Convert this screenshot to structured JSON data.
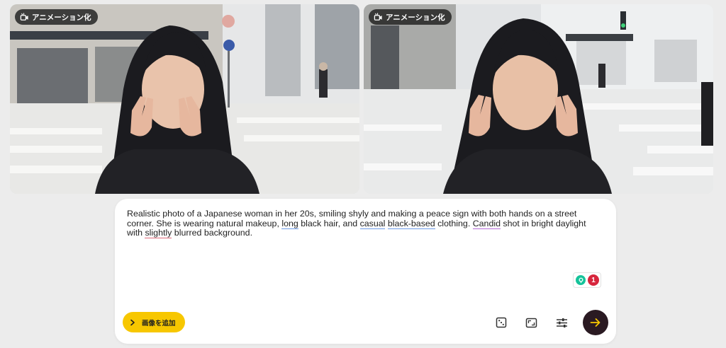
{
  "images": [
    {
      "badge_label": "アニメーション化",
      "badge_icon": "animate-icon"
    },
    {
      "badge_label": "アニメーション化",
      "badge_icon": "animate-icon"
    }
  ],
  "composer": {
    "prompt_parts": {
      "p1": "Realistic photo of a Japanese woman in her 20s, smiling shyly and making a peace sign with both hands on a street corner. She is wearing natural makeup, ",
      "w_long": "long",
      "p2": " black hair, and ",
      "w_casual": "casual",
      "p3": " ",
      "w_black": "black-based",
      "p4": " clothing. ",
      "w_candid": "Candid",
      "p5": " shot in bright daylight with ",
      "w_slightly": "slightly",
      "p6": " blurred background."
    },
    "grammar_count": "1",
    "add_image_label": "画像を追加",
    "tools": [
      "dice-icon",
      "aspect-ratio-icon",
      "settings-sliders-icon"
    ],
    "send_icon": "arrow-right-icon",
    "colors": {
      "accent": "#f7c700",
      "send_bg": "#2a1a22",
      "send_arrow": "#f7c700"
    }
  }
}
